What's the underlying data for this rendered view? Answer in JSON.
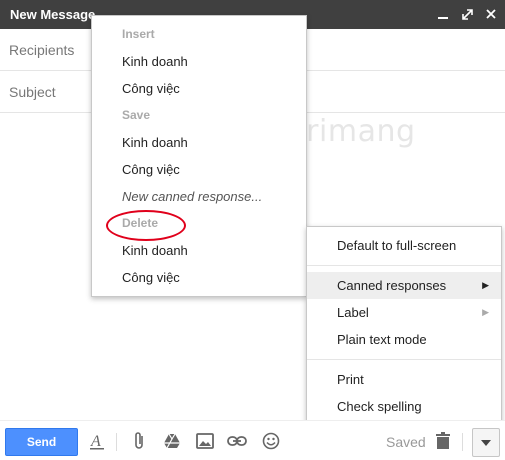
{
  "window": {
    "title": "New Message"
  },
  "fields": {
    "recipients_label": "Recipients",
    "subject_label": "Subject"
  },
  "canned_menu": {
    "insert_header": "Insert",
    "insert_items": [
      "Kinh doanh",
      "Công việc"
    ],
    "save_header": "Save",
    "save_items": [
      "Kinh doanh",
      "Công việc"
    ],
    "new_canned": "New canned response...",
    "delete_header": "Delete",
    "delete_items": [
      "Kinh doanh",
      "Công việc"
    ]
  },
  "more_menu": {
    "default_fullscreen": "Default to full-screen",
    "canned_responses": "Canned responses",
    "label": "Label",
    "plain_text": "Plain text mode",
    "print": "Print",
    "check_spelling": "Check spelling"
  },
  "toolbar": {
    "send_label": "Send",
    "saved_label": "Saved"
  },
  "watermark": {
    "brand": "Quantrimang"
  },
  "colors": {
    "send_blue": "#4d90fe",
    "titlebar": "#404040",
    "annotation_red": "#e0001b"
  }
}
